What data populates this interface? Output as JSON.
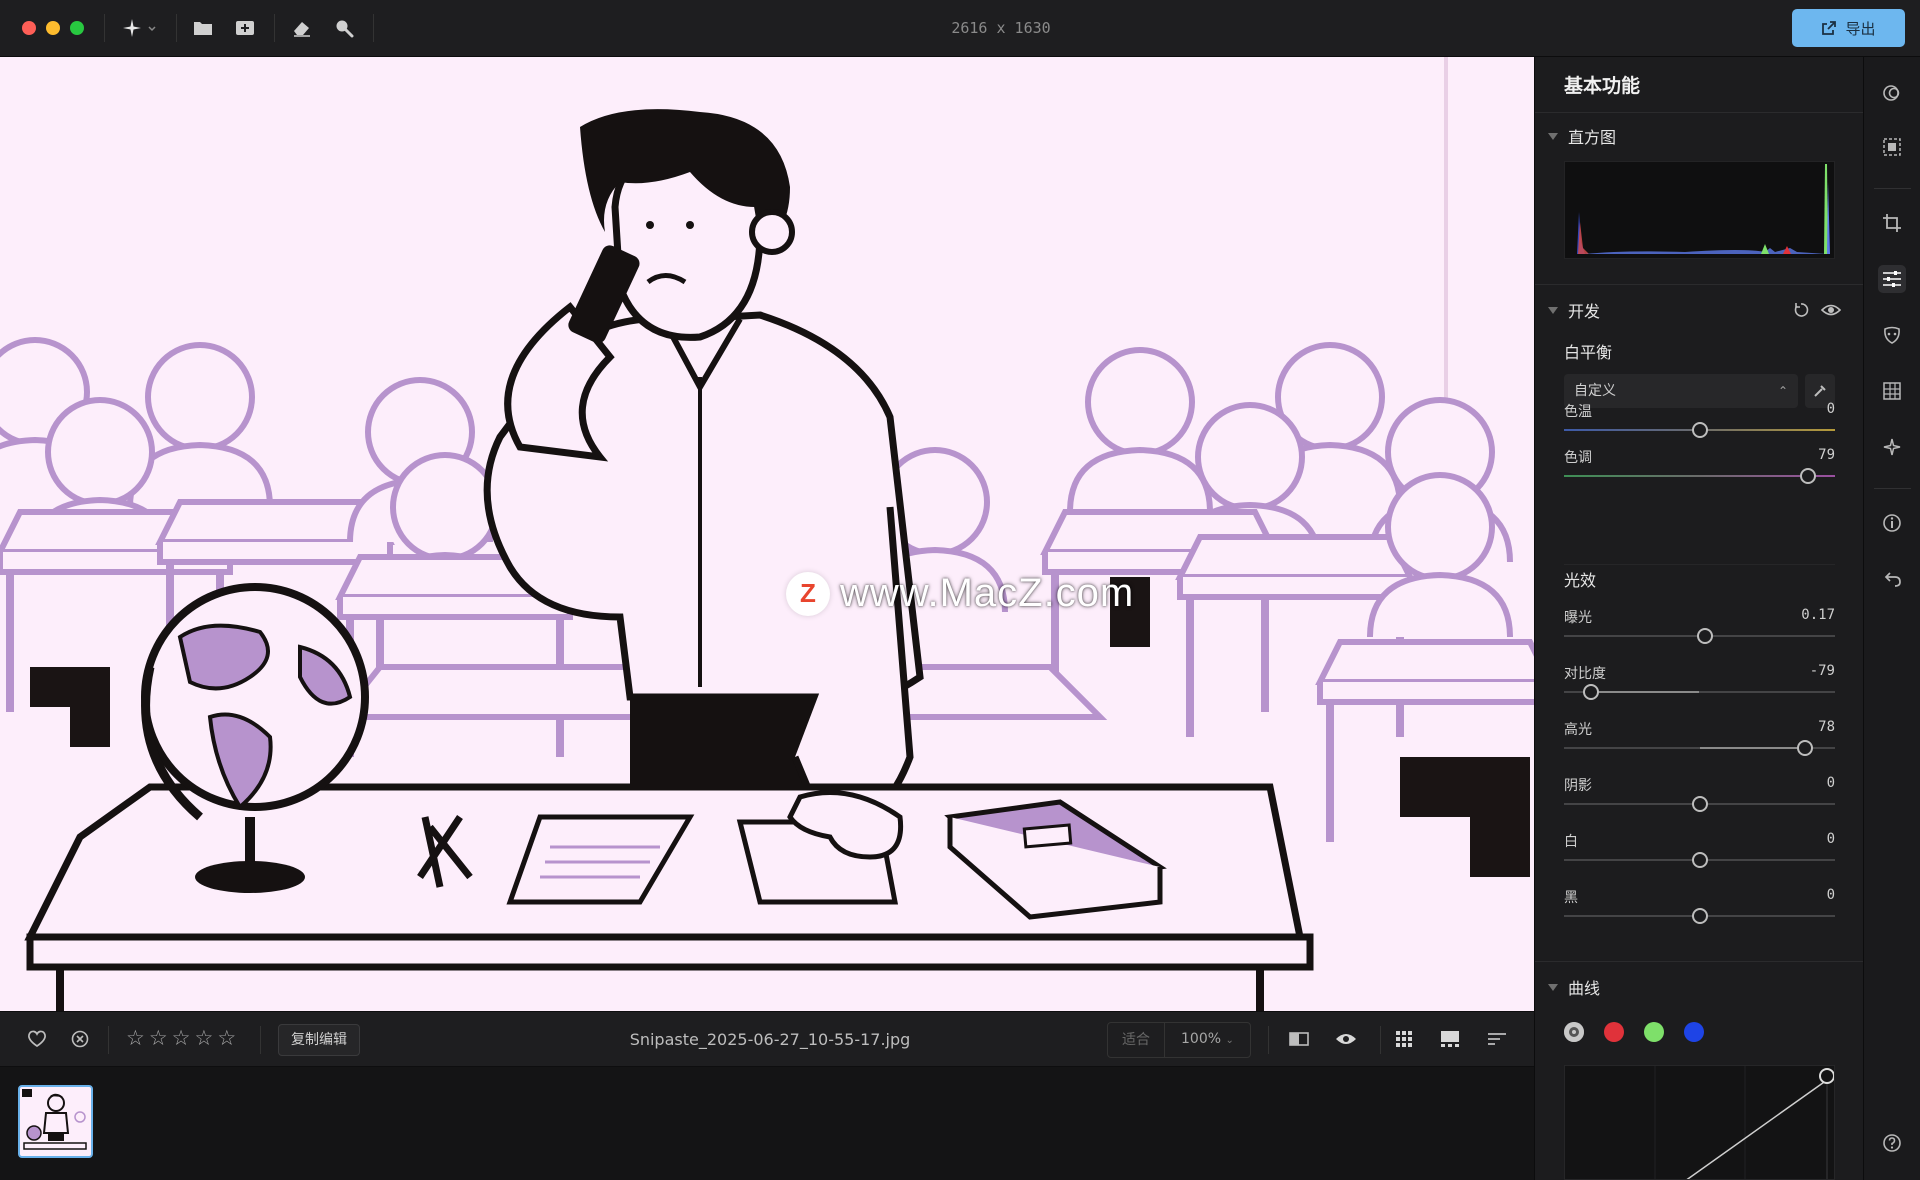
{
  "titlebar": {
    "image_dimensions": "2616 x 1630",
    "export_label": "导出"
  },
  "canvas": {
    "watermark_text": "www.MacZ.com",
    "watermark_badge": "Z"
  },
  "bottombar": {
    "copy_edit_label": "复制编辑",
    "filename": "Snipaste_2025-06-27_10-55-17.jpg",
    "zoom_fit_label": "适合",
    "zoom_value": "100%",
    "rating_stars": [
      "☆",
      "☆",
      "☆",
      "☆",
      "☆"
    ]
  },
  "panel": {
    "title": "基本功能",
    "histogram": {
      "label": "直方图"
    },
    "develop": {
      "label": "开发",
      "white_balance": {
        "label": "白平衡",
        "preset": "自定义",
        "sliders": [
          {
            "label": "色温",
            "value": "0",
            "position": 0.5,
            "type": "temperature"
          },
          {
            "label": "色调",
            "value": "79",
            "position": 0.9,
            "type": "tint"
          }
        ]
      },
      "light": {
        "label": "光效",
        "sliders": [
          {
            "label": "曝光",
            "value": "0.17",
            "position": 0.52,
            "type": "neutral"
          },
          {
            "label": "对比度",
            "value": "-79",
            "position": 0.1,
            "type": "neutral"
          },
          {
            "label": "高光",
            "value": "78",
            "position": 0.89,
            "type": "neutral"
          },
          {
            "label": "阴影",
            "value": "0",
            "position": 0.5,
            "type": "neutral"
          },
          {
            "label": "白",
            "value": "0",
            "position": 0.5,
            "type": "neutral"
          },
          {
            "label": "黑",
            "value": "0",
            "position": 0.5,
            "type": "neutral"
          }
        ]
      }
    },
    "curves": {
      "label": "曲线",
      "channels": [
        {
          "name": "rgb-channel",
          "color": "#c8c8c8"
        },
        {
          "name": "red-channel",
          "color": "#e0323a"
        },
        {
          "name": "green-channel",
          "color": "#7ee06a"
        },
        {
          "name": "blue-channel",
          "color": "#1e44e6"
        }
      ]
    }
  },
  "colors": {
    "accent": "#6db7ef",
    "canvas_bg": "#fdeefb",
    "illustration_purple": "#b793cd"
  },
  "rail": {
    "icons": [
      "masks-icon",
      "select-subject-icon",
      "crop-icon",
      "adjust-sliders-icon",
      "portrait-icon",
      "grid-icon",
      "magic-icon",
      "info-icon",
      "undo-history-icon",
      "help-icon"
    ]
  }
}
